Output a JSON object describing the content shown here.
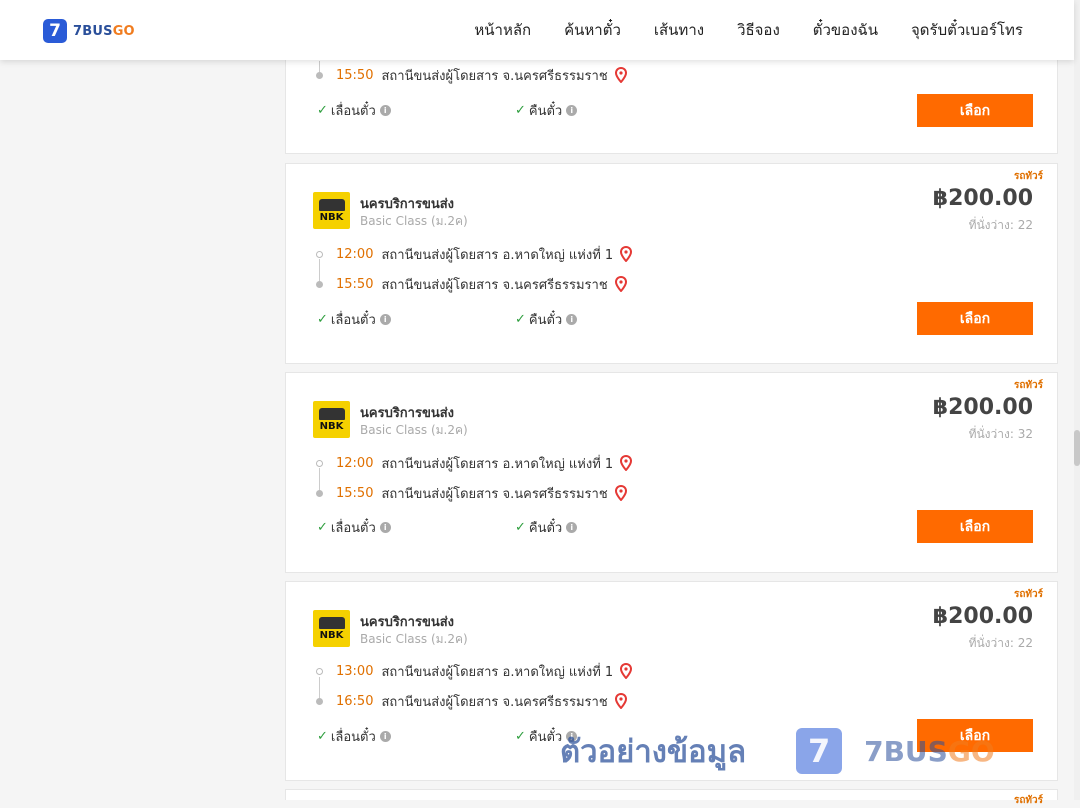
{
  "header": {
    "logo_badge": "7",
    "logo_text_a": "7BUS",
    "logo_text_b": "GO",
    "nav": [
      "หน้าหลัก",
      "ค้นหาตั๋ว",
      "เส้นทาง",
      "วิธีจอง",
      "ตั๋วของฉัน",
      "จุดรับตั๋วเบอร์โทร"
    ]
  },
  "first_card": {
    "arrival_time": "15:50",
    "arrival_station": "สถานีขนส่งผู้โดยสาร จ.นครศรีธรรมราช",
    "feature_1": "เลื่อนตั๋ว",
    "feature_2": "คืนตั๋ว",
    "select_label": "เลือก"
  },
  "cards": [
    {
      "type": "รถทัวร์",
      "operator": "นครบริการขนส่ง",
      "logo_text": "NBK",
      "class": "Basic Class (ม.2ค)",
      "price": "฿200.00",
      "seats": "ที่นั่งว่าง: 22",
      "depart_time": "12:00",
      "depart_station": "สถานีขนส่งผู้โดยสาร อ.หาดใหญ่ แห่งที่ 1",
      "arrive_time": "15:50",
      "arrive_station": "สถานีขนส่งผู้โดยสาร จ.นครศรีธรรมราช",
      "feature_1": "เลื่อนตั๋ว",
      "feature_2": "คืนตั๋ว",
      "select_label": "เลือก"
    },
    {
      "type": "รถทัวร์",
      "operator": "นครบริการขนส่ง",
      "logo_text": "NBK",
      "class": "Basic Class (ม.2ค)",
      "price": "฿200.00",
      "seats": "ที่นั่งว่าง: 32",
      "depart_time": "12:00",
      "depart_station": "สถานีขนส่งผู้โดยสาร อ.หาดใหญ่ แห่งที่ 1",
      "arrive_time": "15:50",
      "arrive_station": "สถานีขนส่งผู้โดยสาร จ.นครศรีธรรมราช",
      "feature_1": "เลื่อนตั๋ว",
      "feature_2": "คืนตั๋ว",
      "select_label": "เลือก"
    },
    {
      "type": "รถทัวร์",
      "operator": "นครบริการขนส่ง",
      "logo_text": "NBK",
      "class": "Basic Class (ม.2ค)",
      "price": "฿200.00",
      "seats": "ที่นั่งว่าง: 22",
      "depart_time": "13:00",
      "depart_station": "สถานีขนส่งผู้โดยสาร อ.หาดใหญ่ แห่งที่ 1",
      "arrive_time": "16:50",
      "arrive_station": "สถานีขนส่งผู้โดยสาร จ.นครศรีธรรมราช",
      "feature_1": "เลื่อนตั๋ว",
      "feature_2": "คืนตั๋ว",
      "select_label": "เลือก"
    }
  ],
  "next_card_type": "รถทัวร์",
  "watermark": {
    "text": "ตัวอย่างข้อมูล",
    "badge": "7",
    "brand_a": "7BUS",
    "brand_b": "GO"
  },
  "colors": {
    "accent": "#ff6a00",
    "time": "#e07000",
    "check": "#2e9e3e",
    "pin": "#e53935",
    "logo_blue": "#2a5bd7"
  },
  "icons": {
    "pin": "map-pin-icon",
    "check": "check-icon",
    "info": "info-icon"
  }
}
